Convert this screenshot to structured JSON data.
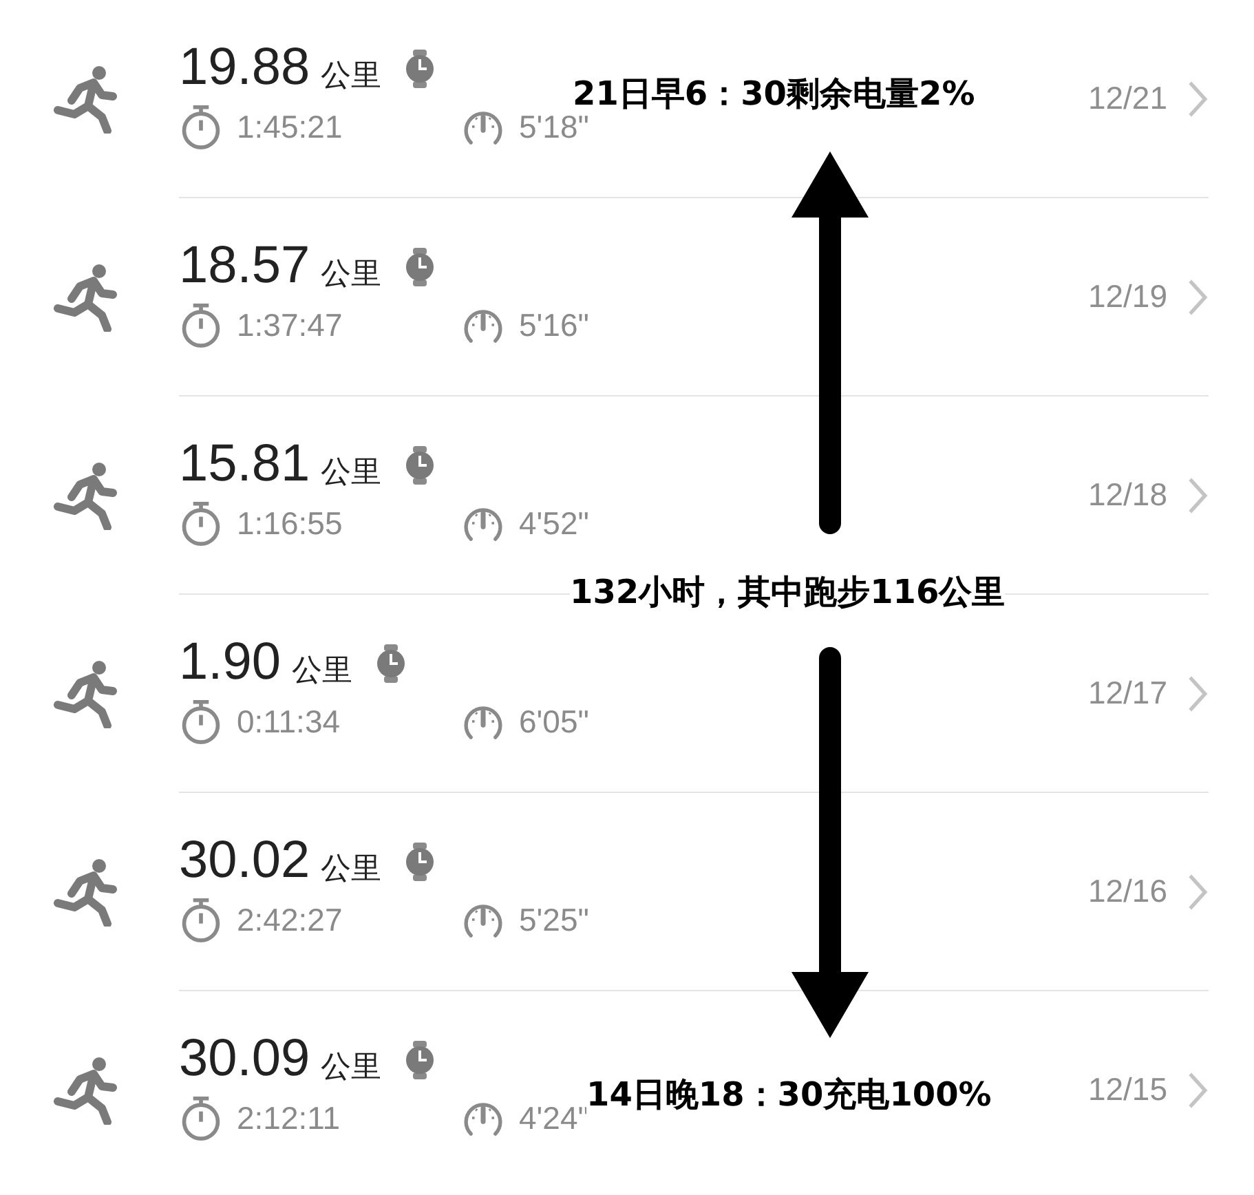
{
  "runs": [
    {
      "distance": "19.88",
      "unit": "公里",
      "duration": "1:45:21",
      "pace": "5'18\"",
      "date": "12/21"
    },
    {
      "distance": "18.57",
      "unit": "公里",
      "duration": "1:37:47",
      "pace": "5'16\"",
      "date": "12/19"
    },
    {
      "distance": "15.81",
      "unit": "公里",
      "duration": "1:16:55",
      "pace": "4'52\"",
      "date": "12/18"
    },
    {
      "distance": "1.90",
      "unit": "公里",
      "duration": "0:11:34",
      "pace": "6'05\"",
      "date": "12/17"
    },
    {
      "distance": "30.02",
      "unit": "公里",
      "duration": "2:42:27",
      "pace": "5'25\"",
      "date": "12/16"
    },
    {
      "distance": "30.09",
      "unit": "公里",
      "duration": "2:12:11",
      "pace": "4'24\"",
      "date": "12/15"
    }
  ],
  "annotations": {
    "top": "21日早6：30剩余电量2%",
    "middle": "132小时，其中跑步116公里",
    "bottom": "14日晚18：30充电100%"
  }
}
